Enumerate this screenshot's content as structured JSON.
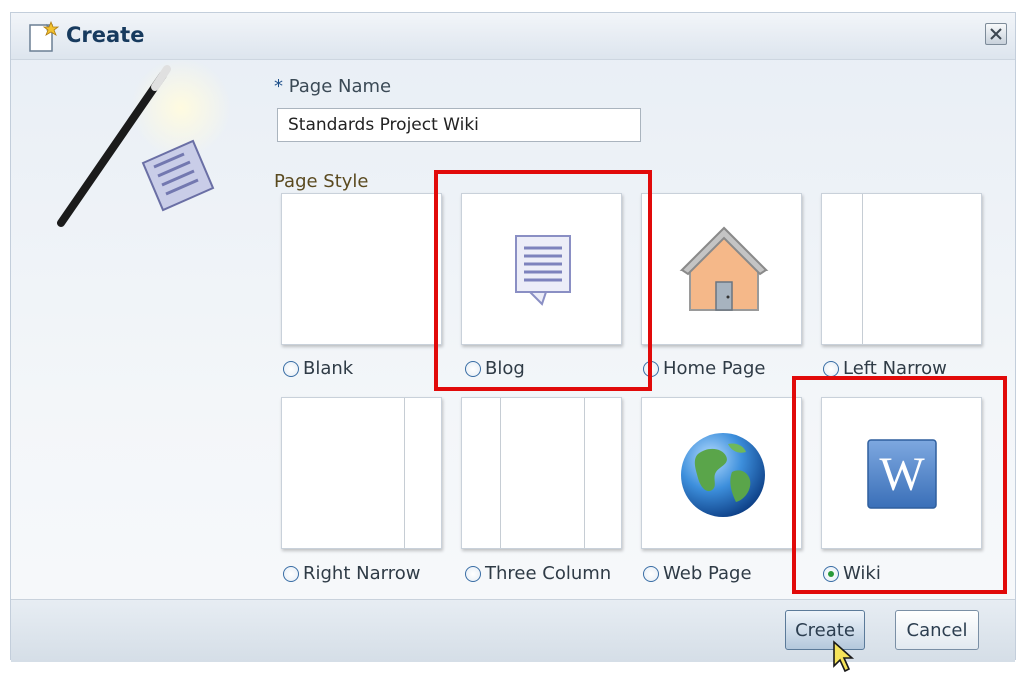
{
  "dialog": {
    "title": "Create",
    "close_icon": "close-icon"
  },
  "form": {
    "page_name_required_marker": "*",
    "page_name_label": "Page Name",
    "page_name_value": "Standards Project Wiki",
    "page_style_label": "Page Style"
  },
  "styles": [
    {
      "label": "Blank",
      "icon": "blank-layout",
      "selected": false
    },
    {
      "label": "Blog",
      "icon": "blog-document-icon",
      "selected": false
    },
    {
      "label": "Home Page",
      "icon": "house-icon",
      "selected": false
    },
    {
      "label": "Left Narrow",
      "icon": "left-narrow-layout",
      "selected": false
    },
    {
      "label": "Right Narrow",
      "icon": "right-narrow-layout",
      "selected": false
    },
    {
      "label": "Three Column",
      "icon": "three-column-layout",
      "selected": false
    },
    {
      "label": "Web Page",
      "icon": "globe-icon",
      "selected": false
    },
    {
      "label": "Wiki",
      "icon": "wiki-w-icon",
      "selected": true
    }
  ],
  "buttons": {
    "create": "Create",
    "cancel": "Cancel"
  },
  "colors": {
    "highlight": "#e10a0a",
    "title": "#173a5e",
    "radio_selected": "#2a9a3a"
  }
}
